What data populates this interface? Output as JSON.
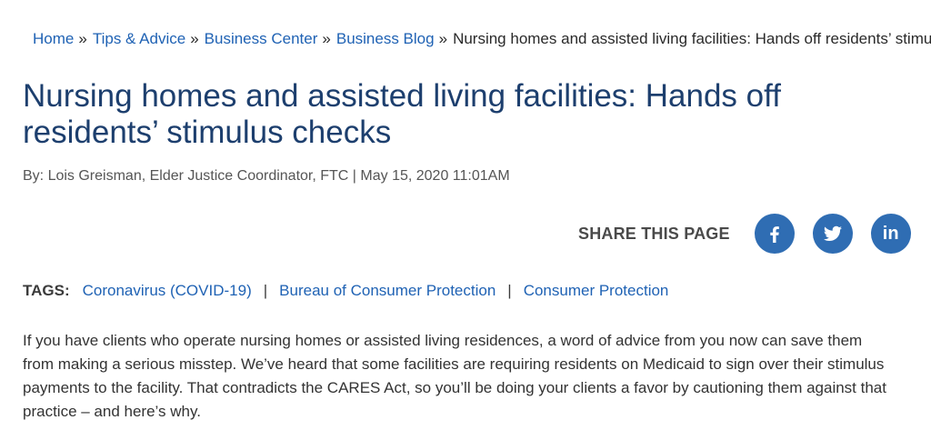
{
  "breadcrumb": {
    "items": [
      "Home",
      "Tips & Advice",
      "Business Center",
      "Business Blog"
    ],
    "separator": "»",
    "current": "Nursing homes and assisted living facilities: Hands off residents’ stimulus checks"
  },
  "article": {
    "title": "Nursing homes and assisted living facilities: Hands off residents’ stimulus checks",
    "byline": "By: Lois Greisman, Elder Justice Coordinator, FTC | May 15, 2020 11:01AM",
    "body": "If you have clients who operate nursing homes or assisted living residences, a word of advice from you now can save them from making a serious misstep. We’ve heard that some facilities are requiring residents on Medicaid to sign over their stimulus payments to the facility. That contradicts the CARES Act, so you’ll be doing your clients a favor by cautioning them against that practice – and here’s why."
  },
  "share": {
    "label": "SHARE THIS PAGE",
    "buttons": [
      {
        "icon": "facebook-icon"
      },
      {
        "icon": "twitter-icon"
      },
      {
        "icon": "linkedin-icon",
        "glyph": "in"
      }
    ],
    "color": "#2f6db3"
  },
  "tags": {
    "label": "TAGS:",
    "items": [
      "Coronavirus (COVID-19)",
      "Bureau of Consumer Protection",
      "Consumer Protection"
    ],
    "separator": "|"
  },
  "colors": {
    "link": "#1f62b4",
    "title": "#1d3f6e"
  }
}
